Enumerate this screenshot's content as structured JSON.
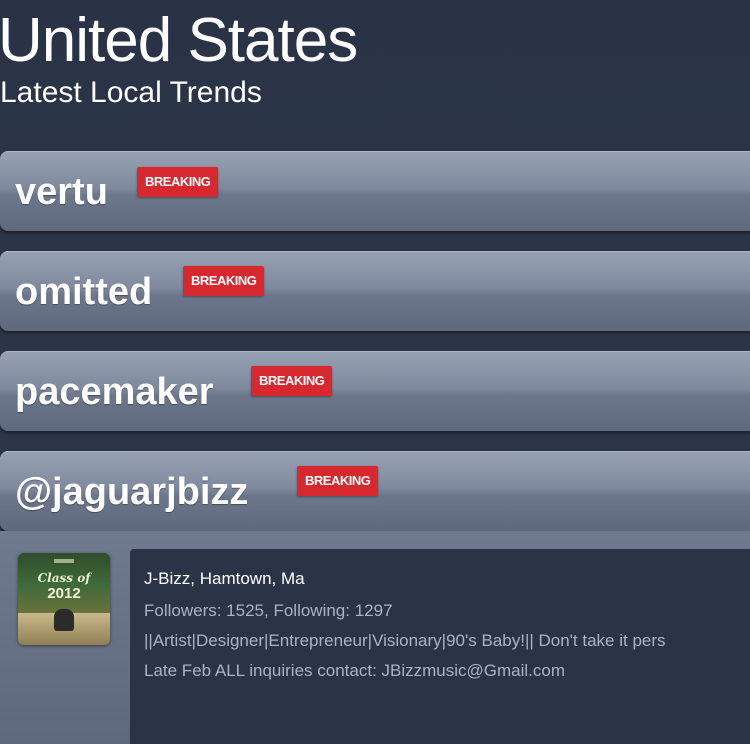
{
  "header": {
    "title": "United States",
    "subtitle": "Latest Local Trends"
  },
  "trends": [
    {
      "name": "vertu",
      "badge": "BREAKING"
    },
    {
      "name": "omitted",
      "badge": "BREAKING"
    },
    {
      "name": "pacemaker",
      "badge": "BREAKING"
    },
    {
      "name": "@jaguarjbizz",
      "badge": "BREAKING"
    }
  ],
  "profile": {
    "avatar_text_top": "Class of",
    "avatar_text_year": "2012",
    "name_location": "J-Bizz, Hamtown, Ma",
    "follow_stats": "Followers: 1525, Following: 1297",
    "bio_line1": "||Artist|Designer|Entrepreneur|Visionary|90's Baby!|| Don't take it pers",
    "bio_line2": "Late Feb ALL inquiries contact: JBizzmusic@Gmail.com"
  },
  "colors": {
    "background": "#2b3447",
    "badge": "#d7282f",
    "trend_bar": "#7f8a9e"
  }
}
